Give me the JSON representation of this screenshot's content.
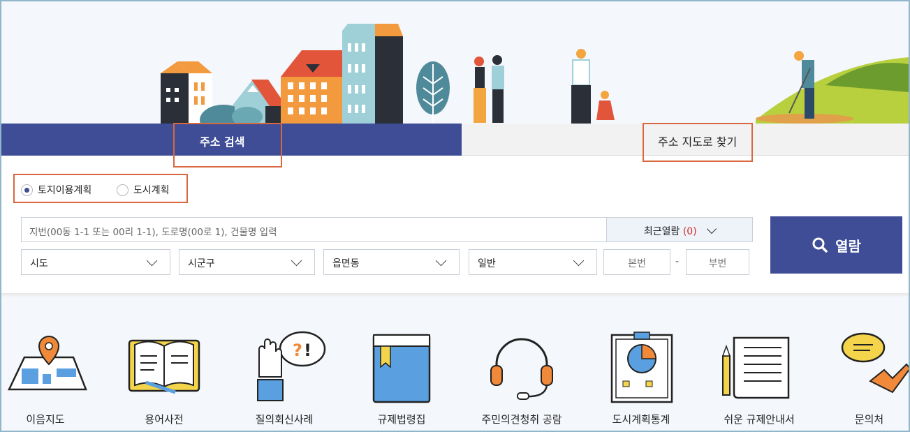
{
  "tabs": {
    "address_search": "주소 검색",
    "map_search": "주소 지도로 찾기"
  },
  "plan_type": {
    "options": [
      {
        "label": "토지이용계획",
        "selected": true
      },
      {
        "label": "도시계획",
        "selected": false
      }
    ]
  },
  "search": {
    "placeholder": "지번(00동 1-1 또는 00리 1-1), 도로명(00로 1), 건물명 입력",
    "recent_label": "최근열람",
    "recent_count": "(0)",
    "selects": [
      "시도",
      "시군구",
      "읍면동",
      "일반"
    ],
    "main_no_placeholder": "본번",
    "dash": "-",
    "sub_no_placeholder": "부번",
    "view_button": "열람"
  },
  "quick_menu": [
    {
      "label": "이음지도",
      "icon": "map-pin-icon"
    },
    {
      "label": "용어사전",
      "icon": "open-book-icon"
    },
    {
      "label": "질의회신사례",
      "icon": "hand-question-icon"
    },
    {
      "label": "규제법령집",
      "icon": "law-book-icon"
    },
    {
      "label": "주민의견청취 공람",
      "icon": "headset-icon"
    },
    {
      "label": "도시계획통계",
      "icon": "statistics-board-icon"
    },
    {
      "label": "쉬운 규제안내서",
      "icon": "scroll-pencil-icon"
    },
    {
      "label": "문의처",
      "icon": "phone-speech-icon"
    }
  ],
  "colors": {
    "primary": "#3f4d96",
    "highlight": "#d9673f",
    "accent_orange": "#f0893a",
    "accent_blue": "#5aa0e0",
    "accent_yellow": "#f3d44a",
    "recent_count": "#d62b2b"
  }
}
